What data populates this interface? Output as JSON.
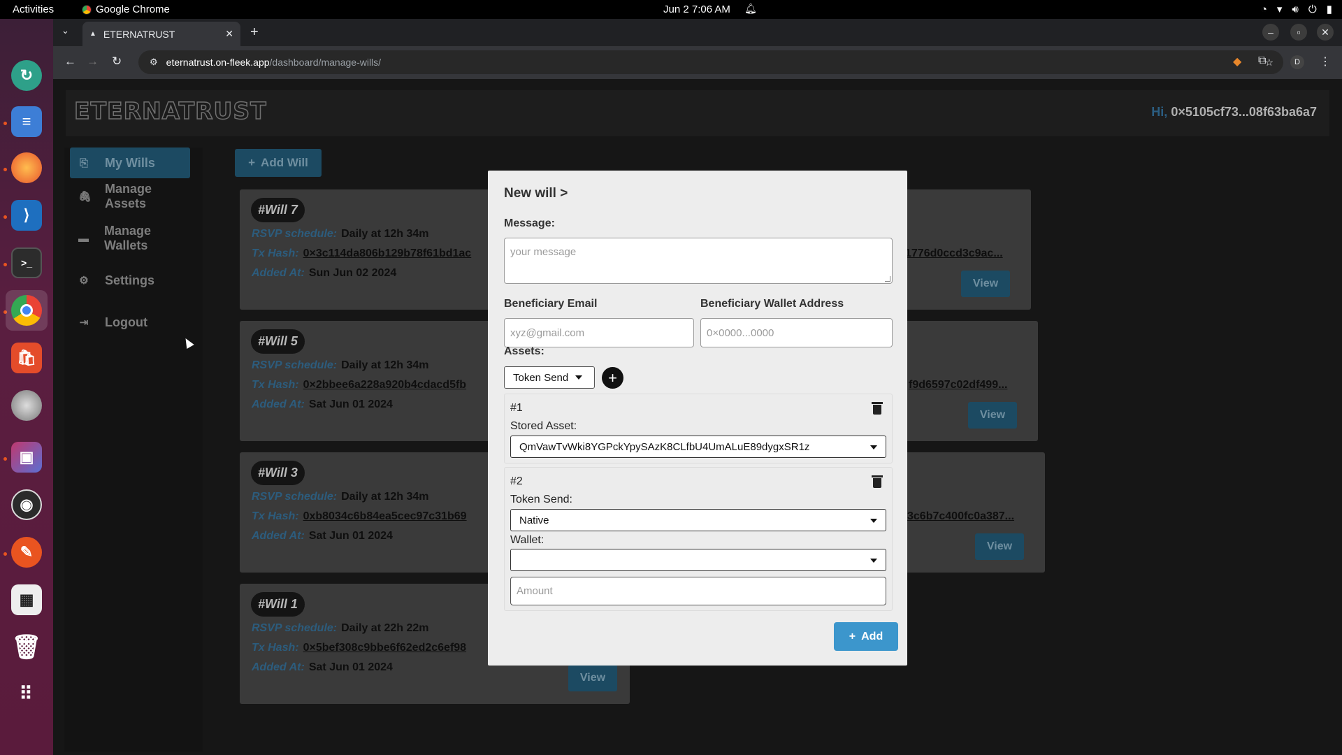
{
  "system": {
    "activities": "Activities",
    "app_name": "Google Chrome",
    "clock": "Jun 2  7:06 AM"
  },
  "browser": {
    "tab_title": "ETERNATRUST",
    "url_host": "eternatrust.on-fleek.app",
    "url_path": "/dashboard/manage-wills/",
    "profile_initial": "D"
  },
  "header": {
    "logo": "ETERNATRUST",
    "greeting_hi": "Hi,",
    "address": "0×5105cf73...08f63ba6a7"
  },
  "sidebar": {
    "items": [
      {
        "label": "My Wills",
        "icon": "scroll-icon"
      },
      {
        "label": "Manage Assets",
        "icon": "paperclip-icon"
      },
      {
        "label": "Manage Wallets",
        "icon": "wallet-icon"
      },
      {
        "label": "Settings",
        "icon": "gear-icon"
      },
      {
        "label": "Logout",
        "icon": "logout-icon"
      }
    ]
  },
  "add_will_label": "Add Will",
  "wills": [
    {
      "id": "#Will 7",
      "rsvp_label": "RSVP schedule:",
      "rsvp": "Daily at 12h 34m",
      "tx_label": "Tx Hash:",
      "tx": "0×3c114da806b129b78f61bd1ac",
      "tx_tail": "1776d0ccd3c9ac...",
      "added_label": "Added At:",
      "added": "Sun Jun 02 2024",
      "view": "View"
    },
    {
      "id": "#Will 5",
      "rsvp_label": "RSVP schedule:",
      "rsvp": "Daily at 12h 34m",
      "tx_label": "Tx Hash:",
      "tx": "0×2bbee6a228a920b4cdacd5fb",
      "tx_tail": "f9d6597c02df499...",
      "added_label": "Added At:",
      "added": "Sat Jun 01 2024",
      "view": "View"
    },
    {
      "id": "#Will 3",
      "rsvp_label": "RSVP schedule:",
      "rsvp": "Daily at 12h 34m",
      "tx_label": "Tx Hash:",
      "tx": "0xb8034c6b84ea5cec97c31b69",
      "tx_tail": "3c6b7c400fc0a387...",
      "added_label": "Added At:",
      "added": "Sat Jun 01 2024",
      "view": "View"
    },
    {
      "id": "#Will 1",
      "rsvp_label": "RSVP schedule:",
      "rsvp": "Daily at 22h 22m",
      "tx_label": "Tx Hash:",
      "tx": "0×5bef308c9bbe6f62ed2c6ef98",
      "tx_tail": "",
      "added_label": "Added At:",
      "added": "Sat Jun 01 2024",
      "view": "View"
    }
  ],
  "modal": {
    "title": "New will >",
    "message_label": "Message:",
    "message_placeholder": "your message",
    "email_label": "Beneficiary Email",
    "email_placeholder": "xyz@gmail.com",
    "wallet_label": "Beneficiary Wallet Address",
    "wallet_placeholder": "0×0000...0000",
    "assets_label": "Assets:",
    "asset_type": "Token Send",
    "asset1": {
      "num": "#1",
      "label": "Stored Asset:",
      "value": "QmVawTvWki8YGPckYpySAzK8CLfbU4UmALuE89dygxSR1z"
    },
    "asset2": {
      "num": "#2",
      "token_label": "Token Send:",
      "token_value": "Native",
      "wallet_label": "Wallet:",
      "wallet_value": "",
      "amount_placeholder": "Amount"
    },
    "add_label": "Add"
  },
  "colors": {
    "accent": "#3c96cc",
    "sidebar_active": "#1c4a62",
    "card": "#3a3a3a"
  }
}
